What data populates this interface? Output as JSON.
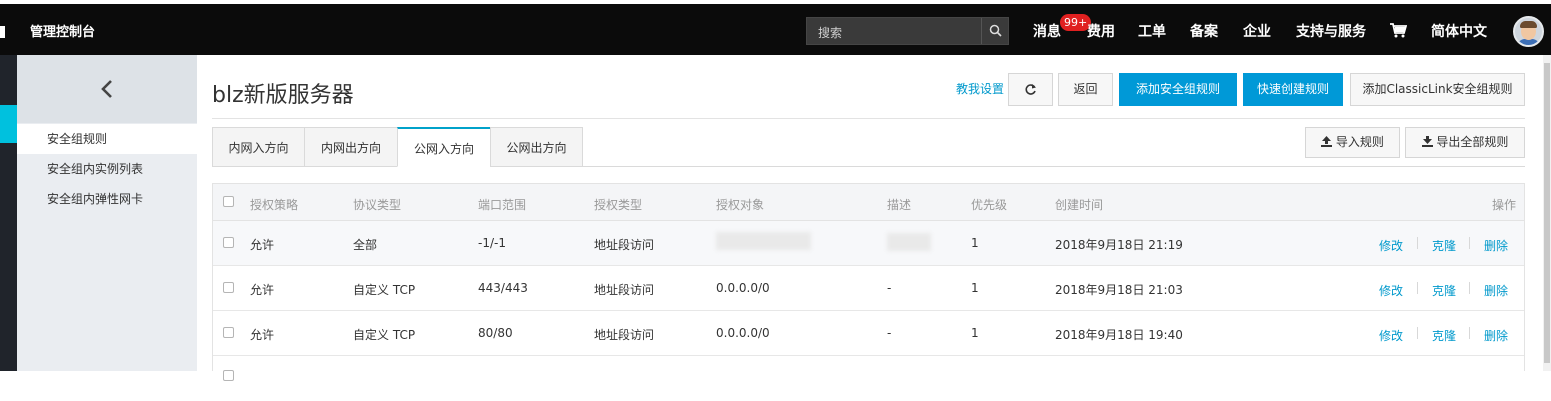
{
  "topbar": {
    "console_title": "管理控制台",
    "search_placeholder": "搜索",
    "nav": [
      "消息",
      "费用",
      "工单",
      "备案",
      "企业",
      "支持与服务",
      "简体中文"
    ],
    "message_badge": "99+"
  },
  "side": {
    "items": [
      "安全组规则",
      "安全组内实例列表",
      "安全组内弹性网卡"
    ],
    "active_index": 0
  },
  "page": {
    "title": "blz新版服务器",
    "help_link": "教我设置",
    "back_button": "返回",
    "add_rule_button": "添加安全组规则",
    "quick_create_button": "快速创建规则",
    "classiclink_button": "添加ClassicLink安全组规则"
  },
  "tabs": [
    "内网入方向",
    "内网出方向",
    "公网入方向",
    "公网出方向"
  ],
  "active_tab": 2,
  "toolbar": {
    "import": "导入规则",
    "export": "导出全部规则"
  },
  "table": {
    "headers": [
      "授权策略",
      "协议类型",
      "端口范围",
      "授权类型",
      "授权对象",
      "描述",
      "优先级",
      "创建时间",
      "操作"
    ],
    "rows": [
      {
        "policy": "允许",
        "protocol": "全部",
        "port": "-1/-1",
        "auth_type": "地址段访问",
        "object": "",
        "desc": "",
        "priority": "1",
        "created": "2018年9月18日 21:19"
      },
      {
        "policy": "允许",
        "protocol": "自定义 TCP",
        "port": "443/443",
        "auth_type": "地址段访问",
        "object": "0.0.0.0/0",
        "desc": "-",
        "priority": "1",
        "created": "2018年9月18日 21:03"
      },
      {
        "policy": "允许",
        "protocol": "自定义 TCP",
        "port": "80/80",
        "auth_type": "地址段访问",
        "object": "0.0.0.0/0",
        "desc": "-",
        "priority": "1",
        "created": "2018年9月18日 19:40"
      }
    ],
    "actions": [
      "修改",
      "克隆",
      "删除"
    ]
  },
  "colors": {
    "accent": "#0099d7",
    "topbar": "#0b0b0b",
    "link": "#0099cc",
    "badge": "#e02020"
  },
  "icons": [
    "search-icon",
    "chevron-left-icon",
    "refresh-icon",
    "cart-icon",
    "upload-icon",
    "download-icon"
  ]
}
